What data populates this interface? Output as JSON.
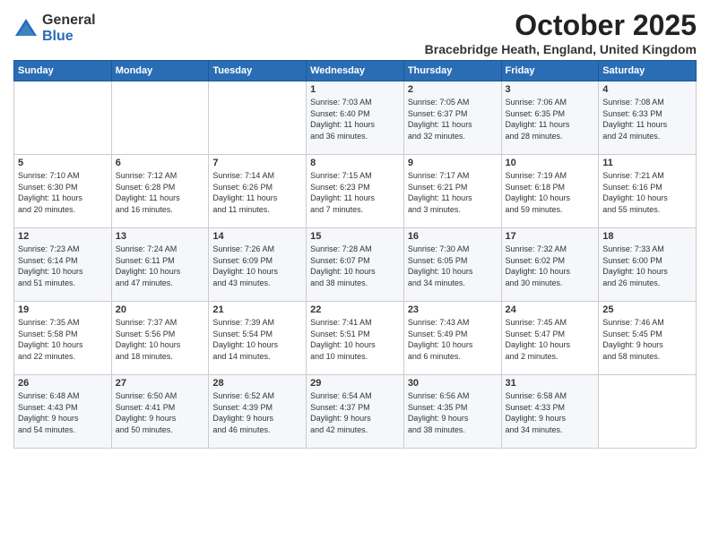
{
  "logo": {
    "general": "General",
    "blue": "Blue"
  },
  "title": "October 2025",
  "subtitle": "Bracebridge Heath, England, United Kingdom",
  "days_header": [
    "Sunday",
    "Monday",
    "Tuesday",
    "Wednesday",
    "Thursday",
    "Friday",
    "Saturday"
  ],
  "weeks": [
    [
      {
        "day": "",
        "info": ""
      },
      {
        "day": "",
        "info": ""
      },
      {
        "day": "",
        "info": ""
      },
      {
        "day": "1",
        "info": "Sunrise: 7:03 AM\nSunset: 6:40 PM\nDaylight: 11 hours\nand 36 minutes."
      },
      {
        "day": "2",
        "info": "Sunrise: 7:05 AM\nSunset: 6:37 PM\nDaylight: 11 hours\nand 32 minutes."
      },
      {
        "day": "3",
        "info": "Sunrise: 7:06 AM\nSunset: 6:35 PM\nDaylight: 11 hours\nand 28 minutes."
      },
      {
        "day": "4",
        "info": "Sunrise: 7:08 AM\nSunset: 6:33 PM\nDaylight: 11 hours\nand 24 minutes."
      }
    ],
    [
      {
        "day": "5",
        "info": "Sunrise: 7:10 AM\nSunset: 6:30 PM\nDaylight: 11 hours\nand 20 minutes."
      },
      {
        "day": "6",
        "info": "Sunrise: 7:12 AM\nSunset: 6:28 PM\nDaylight: 11 hours\nand 16 minutes."
      },
      {
        "day": "7",
        "info": "Sunrise: 7:14 AM\nSunset: 6:26 PM\nDaylight: 11 hours\nand 11 minutes."
      },
      {
        "day": "8",
        "info": "Sunrise: 7:15 AM\nSunset: 6:23 PM\nDaylight: 11 hours\nand 7 minutes."
      },
      {
        "day": "9",
        "info": "Sunrise: 7:17 AM\nSunset: 6:21 PM\nDaylight: 11 hours\nand 3 minutes."
      },
      {
        "day": "10",
        "info": "Sunrise: 7:19 AM\nSunset: 6:18 PM\nDaylight: 10 hours\nand 59 minutes."
      },
      {
        "day": "11",
        "info": "Sunrise: 7:21 AM\nSunset: 6:16 PM\nDaylight: 10 hours\nand 55 minutes."
      }
    ],
    [
      {
        "day": "12",
        "info": "Sunrise: 7:23 AM\nSunset: 6:14 PM\nDaylight: 10 hours\nand 51 minutes."
      },
      {
        "day": "13",
        "info": "Sunrise: 7:24 AM\nSunset: 6:11 PM\nDaylight: 10 hours\nand 47 minutes."
      },
      {
        "day": "14",
        "info": "Sunrise: 7:26 AM\nSunset: 6:09 PM\nDaylight: 10 hours\nand 43 minutes."
      },
      {
        "day": "15",
        "info": "Sunrise: 7:28 AM\nSunset: 6:07 PM\nDaylight: 10 hours\nand 38 minutes."
      },
      {
        "day": "16",
        "info": "Sunrise: 7:30 AM\nSunset: 6:05 PM\nDaylight: 10 hours\nand 34 minutes."
      },
      {
        "day": "17",
        "info": "Sunrise: 7:32 AM\nSunset: 6:02 PM\nDaylight: 10 hours\nand 30 minutes."
      },
      {
        "day": "18",
        "info": "Sunrise: 7:33 AM\nSunset: 6:00 PM\nDaylight: 10 hours\nand 26 minutes."
      }
    ],
    [
      {
        "day": "19",
        "info": "Sunrise: 7:35 AM\nSunset: 5:58 PM\nDaylight: 10 hours\nand 22 minutes."
      },
      {
        "day": "20",
        "info": "Sunrise: 7:37 AM\nSunset: 5:56 PM\nDaylight: 10 hours\nand 18 minutes."
      },
      {
        "day": "21",
        "info": "Sunrise: 7:39 AM\nSunset: 5:54 PM\nDaylight: 10 hours\nand 14 minutes."
      },
      {
        "day": "22",
        "info": "Sunrise: 7:41 AM\nSunset: 5:51 PM\nDaylight: 10 hours\nand 10 minutes."
      },
      {
        "day": "23",
        "info": "Sunrise: 7:43 AM\nSunset: 5:49 PM\nDaylight: 10 hours\nand 6 minutes."
      },
      {
        "day": "24",
        "info": "Sunrise: 7:45 AM\nSunset: 5:47 PM\nDaylight: 10 hours\nand 2 minutes."
      },
      {
        "day": "25",
        "info": "Sunrise: 7:46 AM\nSunset: 5:45 PM\nDaylight: 9 hours\nand 58 minutes."
      }
    ],
    [
      {
        "day": "26",
        "info": "Sunrise: 6:48 AM\nSunset: 4:43 PM\nDaylight: 9 hours\nand 54 minutes."
      },
      {
        "day": "27",
        "info": "Sunrise: 6:50 AM\nSunset: 4:41 PM\nDaylight: 9 hours\nand 50 minutes."
      },
      {
        "day": "28",
        "info": "Sunrise: 6:52 AM\nSunset: 4:39 PM\nDaylight: 9 hours\nand 46 minutes."
      },
      {
        "day": "29",
        "info": "Sunrise: 6:54 AM\nSunset: 4:37 PM\nDaylight: 9 hours\nand 42 minutes."
      },
      {
        "day": "30",
        "info": "Sunrise: 6:56 AM\nSunset: 4:35 PM\nDaylight: 9 hours\nand 38 minutes."
      },
      {
        "day": "31",
        "info": "Sunrise: 6:58 AM\nSunset: 4:33 PM\nDaylight: 9 hours\nand 34 minutes."
      },
      {
        "day": "",
        "info": ""
      }
    ]
  ]
}
